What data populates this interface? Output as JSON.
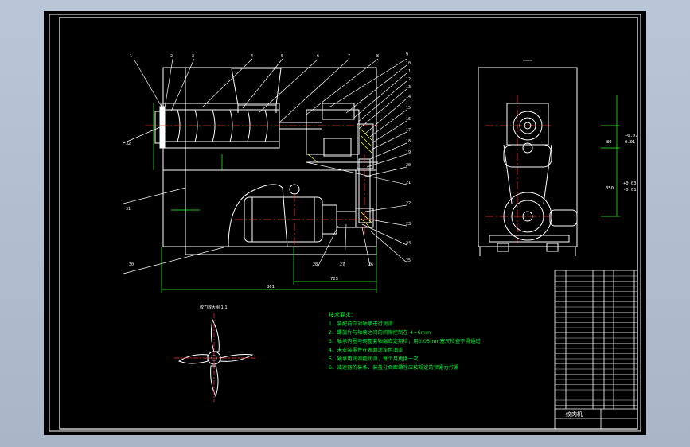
{
  "drawing": {
    "title": "绞肉机",
    "tech_requirements": {
      "heading": "技术要求:",
      "items": [
        "1、装配前应对轴承进行润滑",
        "2、螺旋片与轴套之间的间隙控制在 4~6mm",
        "3、轴承内圈与调整套轴端应定期检，用0.05mm塞尺检查不得通过",
        "4、未安装零件在表面涂漆色油漆",
        "5、轴承用润滑脂润滑，每个月更换一次",
        "6、减速器的装条、装盖分合面螺栓应按规定的预紧力拧紧"
      ]
    },
    "detail_label": "绞刀放大图 1:1",
    "dimensions": {
      "overall_length": "861",
      "motor_span": "723",
      "tol_upper": "+0.07",
      "tol_lower": "0.01",
      "right_upper": "80",
      "right_lower_upper": "+0.03",
      "right_lower_lower": "-0.01",
      "right_lower_nom": "350"
    },
    "balloons": [
      "1",
      "2",
      "3",
      "4",
      "5",
      "6",
      "7",
      "8",
      "9",
      "10",
      "11",
      "12",
      "13",
      "14",
      "15",
      "16",
      "17",
      "18",
      "19",
      "20",
      "21",
      "22",
      "23",
      "24",
      "25",
      "26",
      "27",
      "28",
      "30",
      "31",
      "32"
    ]
  },
  "colors": {
    "background": "#000000",
    "outline": "#ffffff",
    "leader": "#ffffff",
    "dimension": "#33ff33",
    "center": "#ff3333",
    "hatch": "#ffff33",
    "tech_text": "#00ff33",
    "border": "#ffffff"
  }
}
